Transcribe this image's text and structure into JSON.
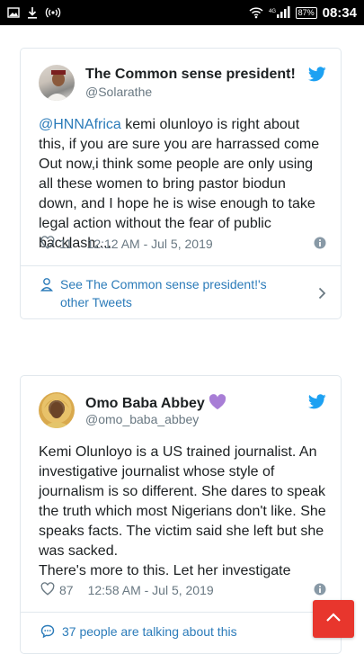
{
  "status_bar": {
    "battery": "87",
    "time": "08:34"
  },
  "tweets": [
    {
      "name": "The Common sense president!",
      "handle": "@Solarathe",
      "mention": "@HNNAfrica",
      "text": " kemi olunloyo is right about this, if you are sure you are harrassed come Out now,i think some people are only using all these women to bring pastor biodun down, and I hope he is wise enough to take legal action without the fear of public backlash....",
      "likes": "11",
      "timestamp": "12:12 AM - Jul 5, 2019",
      "footer": "See The Common sense president!'s other Tweets"
    },
    {
      "name": "Omo Baba Abbey",
      "handle": "@omo_baba_abbey",
      "text": "Kemi Olunloyo is a US trained journalist. An investigative journalist whose style of journalism is so different. She dares to speak the truth which most Nigerians don't like. She speaks facts. The victim said she left but she was sacked.\nThere's more to this. Let her investigate",
      "likes": "87",
      "timestamp": "12:58 AM - Jul 5, 2019",
      "footer": "37 people are talking about this"
    }
  ],
  "colors": {
    "link": "#2b7bb9",
    "twitter_blue": "#1da1f2",
    "scroll_button": "#e8362d",
    "purple_heart": "#a87ed6"
  }
}
